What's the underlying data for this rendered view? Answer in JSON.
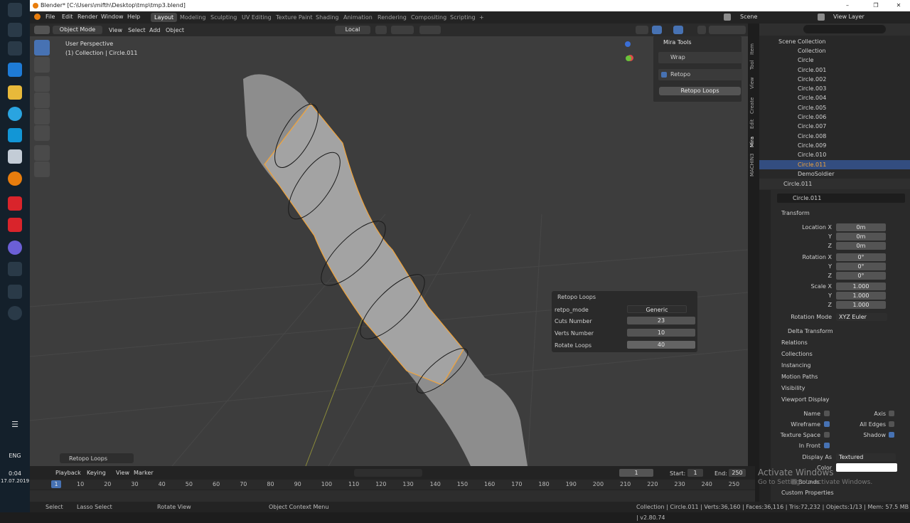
{
  "window": {
    "title": "Blender* [C:\\Users\\mifth\\Desktop\\tmp\\tmp3.blend]",
    "min": "–",
    "max": "❐",
    "close": "✕"
  },
  "taskbar": {
    "time": "0:04",
    "date": "17.07.2019",
    "lang": "ENG"
  },
  "menu": [
    "File",
    "Edit",
    "Render",
    "Window",
    "Help"
  ],
  "workspaces": [
    "Layout",
    "Modeling",
    "Sculpting",
    "UV Editing",
    "Texture Paint",
    "Shading",
    "Animation",
    "Rendering",
    "Compositing",
    "Scripting",
    "+"
  ],
  "scene": {
    "label": "Scene",
    "view_layer": "View Layer"
  },
  "header": {
    "mode": "Object Mode",
    "view": "View",
    "select": "Select",
    "add": "Add",
    "object": "Object",
    "orientation": "Local"
  },
  "viewport": {
    "persp": "User Perspective",
    "collection": "(1) Collection | Circle.011",
    "last_op": "Retopo Loops"
  },
  "npanel": {
    "title": "Mira Tools",
    "wrap": "Wrap",
    "retopo": "Retopo",
    "retopo_loops": "Retopo Loops",
    "tabs": [
      "Item",
      "Tool",
      "View",
      "Create",
      "Edit",
      "Mira",
      "MACHIN3"
    ]
  },
  "redo": {
    "title": "Retopo Loops",
    "mode_label": "retpo_mode",
    "mode_value": "Generic",
    "cuts_label": "Cuts Number",
    "cuts": "23",
    "verts_label": "Verts Number",
    "verts": "10",
    "rot_label": "Rotate Loops",
    "rot": "40"
  },
  "timeline": {
    "playback": "Playback",
    "keying": "Keying",
    "view": "View",
    "marker": "Marker",
    "frame": "1",
    "start_label": "Start:",
    "start": "1",
    "end_label": "End:",
    "end": "250",
    "current": "1",
    "ticks": [
      "10",
      "20",
      "30",
      "40",
      "50",
      "60",
      "70",
      "80",
      "90",
      "100",
      "110",
      "120",
      "130",
      "140",
      "150",
      "160",
      "170",
      "180",
      "190",
      "200",
      "210",
      "220",
      "230",
      "240",
      "250"
    ]
  },
  "status": {
    "select": "Select",
    "lasso": "Lasso Select",
    "rotate": "Rotate View",
    "context": "Object Context Menu",
    "stats": "Collection | Circle.011 | Verts:36,160 | Faces:36,116 | Tris:72,232 | Objects:1/13 | Mem: 57.5 MB | v2.80.74"
  },
  "outliner": {
    "root": "Scene Collection",
    "collection": "Collection",
    "items": [
      "Circle",
      "Circle.001",
      "Circle.002",
      "Circle.003",
      "Circle.004",
      "Circle.005",
      "Circle.006",
      "Circle.007",
      "Circle.008",
      "Circle.009",
      "Circle.010",
      "Circle.011",
      "DemoSoldier"
    ],
    "selected": "Circle.011"
  },
  "props": {
    "object": "Circle.011",
    "data_name": "Circle.011",
    "transform": "Transform",
    "loc_x_label": "Location X",
    "y_label": "Y",
    "z_label": "Z",
    "rot_x_label": "Rotation X",
    "scale_x_label": "Scale X",
    "loc_x": "0m",
    "loc_y": "0m",
    "loc_z": "0m",
    "rot_x": "0°",
    "rot_y": "0°",
    "rot_z": "0°",
    "scale_x": "1.000",
    "scale_y": "1.000",
    "scale_z": "1.000",
    "rot_mode_label": "Rotation Mode",
    "rot_mode": "XYZ Euler",
    "delta": "Delta Transform",
    "relations": "Relations",
    "collections": "Collections",
    "instancing": "Instancing",
    "motion": "Motion Paths",
    "visibility": "Visibility",
    "vdisplay": "Viewport Display",
    "name_label": "Name",
    "axis_label": "Axis",
    "wire_label": "Wireframe",
    "alledges_label": "All Edges",
    "texspace_label": "Texture Space",
    "shadow_label": "Shadow",
    "infront_label": "In Front",
    "display_as_label": "Display As",
    "display_as": "Textured",
    "color_label": "Color",
    "bounds": "Bounds",
    "custom": "Custom Properties"
  },
  "watermark": {
    "line1": "Activate Windows",
    "line2": "Go to Settings to activate Windows."
  },
  "colors": {
    "accent": "#4772b3",
    "selected_orange": "#f2a43a",
    "mesh_green": "#5fd35f"
  }
}
